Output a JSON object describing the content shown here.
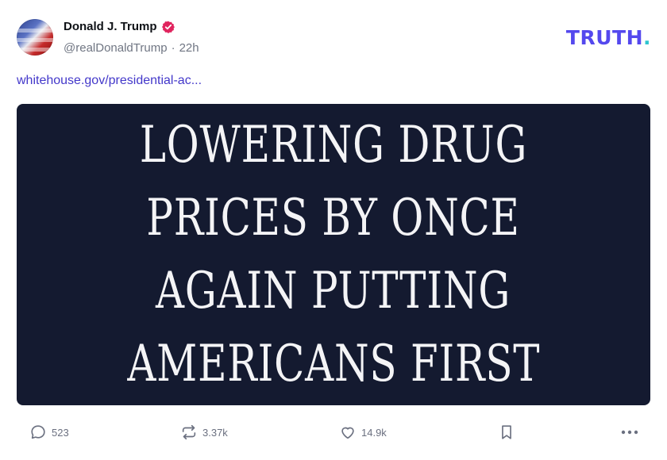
{
  "author": {
    "display_name": "Donald J. Trump",
    "handle": "@realDonaldTrump",
    "separator": "·",
    "timestamp": "22h"
  },
  "brand": {
    "logo_text": "TRUTH",
    "logo_dot": ".",
    "colors": {
      "primary": "#5448ee",
      "dot": "#2ec5cf"
    }
  },
  "post": {
    "link_text": "whitehouse.gov/presidential-ac...",
    "media": {
      "headline_lines": [
        "LOWERING DRUG",
        "PRICES BY ONCE",
        "AGAIN PUTTING",
        "AMERICANS FIRST"
      ],
      "background_color": "#141a30"
    }
  },
  "actions": {
    "reply": {
      "icon": "reply-icon",
      "count": "523"
    },
    "retruth": {
      "icon": "retruth-icon",
      "count": "3.37k"
    },
    "like": {
      "icon": "heart-icon",
      "count": "14.9k"
    },
    "bookmark": {
      "icon": "bookmark-icon"
    },
    "more": {
      "icon": "more-icon"
    }
  },
  "verified_badge_color": "#e0245e"
}
